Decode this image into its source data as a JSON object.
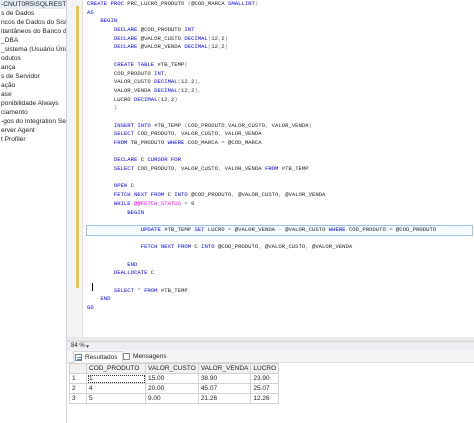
{
  "object_explorer": {
    "items": [
      {
        "label": "-CNUT0R5\\SQLRESTAU"
      },
      {
        "label": "s de Dados"
      },
      {
        "label": "ncos de Dados do Siste"
      },
      {
        "label": "itantâneos do Banco d"
      },
      {
        "label": "_DBA"
      },
      {
        "label": "_sistema (Usuário Únic"
      },
      {
        "label": "odutos"
      },
      {
        "label": "ança"
      },
      {
        "label": "s de Servidor"
      },
      {
        "label": "ação"
      },
      {
        "label": "ase"
      },
      {
        "label": "ponibilidade Always"
      },
      {
        "label": "ciamento"
      },
      {
        "label": "-gos do Integration Ser"
      },
      {
        "label": "erver Agent"
      },
      {
        "label": "t Profiler"
      }
    ]
  },
  "editor": {
    "lines": [
      [
        {
          "c": "k",
          "t": "CREATE PROC "
        },
        {
          "c": "t",
          "t": "PRC_LUCRO_PRODUTO "
        },
        {
          "c": "g",
          "t": "("
        },
        {
          "c": "t",
          "t": "@COD_MARCA "
        },
        {
          "c": "k",
          "t": "SMALLINT"
        },
        {
          "c": "g",
          "t": ")"
        }
      ],
      [
        {
          "c": "k",
          "t": "AS"
        }
      ],
      [
        {
          "c": "k",
          "t": "    BEGIN"
        }
      ],
      [
        {
          "c": "k",
          "t": "        DECLARE "
        },
        {
          "c": "t",
          "t": "@COD_PRODUTO "
        },
        {
          "c": "k",
          "t": "INT"
        }
      ],
      [
        {
          "c": "k",
          "t": "        DECLARE "
        },
        {
          "c": "t",
          "t": "@VALOR_CUSTO "
        },
        {
          "c": "k",
          "t": "DECIMAL"
        },
        {
          "c": "g",
          "t": "("
        },
        {
          "c": "t",
          "t": "12"
        },
        {
          "c": "g",
          "t": ","
        },
        {
          "c": "t",
          "t": "2"
        },
        {
          "c": "g",
          "t": ")"
        }
      ],
      [
        {
          "c": "k",
          "t": "        DECLARE "
        },
        {
          "c": "t",
          "t": "@VALOR_VENDA "
        },
        {
          "c": "k",
          "t": "DECIMAL"
        },
        {
          "c": "g",
          "t": "("
        },
        {
          "c": "t",
          "t": "12"
        },
        {
          "c": "g",
          "t": ","
        },
        {
          "c": "t",
          "t": "2"
        },
        {
          "c": "g",
          "t": ")"
        }
      ],
      [
        {
          "c": "t",
          "t": ""
        }
      ],
      [
        {
          "c": "k",
          "t": "        CREATE TABLE "
        },
        {
          "c": "t",
          "t": "#TB_TEMP"
        },
        {
          "c": "g",
          "t": "("
        }
      ],
      [
        {
          "c": "t",
          "t": "        COD_PRODUTO "
        },
        {
          "c": "k",
          "t": "INT"
        },
        {
          "c": "g",
          "t": ","
        }
      ],
      [
        {
          "c": "t",
          "t": "        VALOR_CUSTO "
        },
        {
          "c": "k",
          "t": "DECIMAL"
        },
        {
          "c": "g",
          "t": "("
        },
        {
          "c": "t",
          "t": "12"
        },
        {
          "c": "g",
          "t": ","
        },
        {
          "c": "t",
          "t": "2"
        },
        {
          "c": "g",
          "t": "),"
        }
      ],
      [
        {
          "c": "t",
          "t": "        VALOR_VENDA "
        },
        {
          "c": "k",
          "t": "DECIMAL"
        },
        {
          "c": "g",
          "t": "("
        },
        {
          "c": "t",
          "t": "12"
        },
        {
          "c": "g",
          "t": ","
        },
        {
          "c": "t",
          "t": "2"
        },
        {
          "c": "g",
          "t": "),"
        }
      ],
      [
        {
          "c": "t",
          "t": "        LUCRO "
        },
        {
          "c": "k",
          "t": "DECIMAL"
        },
        {
          "c": "g",
          "t": "("
        },
        {
          "c": "t",
          "t": "12"
        },
        {
          "c": "g",
          "t": ","
        },
        {
          "c": "t",
          "t": "2"
        },
        {
          "c": "g",
          "t": ")"
        }
      ],
      [
        {
          "c": "g",
          "t": "        )"
        }
      ],
      [
        {
          "c": "t",
          "t": ""
        }
      ],
      [
        {
          "c": "k",
          "t": "        INSERT INTO "
        },
        {
          "c": "t",
          "t": "#TB_TEMP "
        },
        {
          "c": "g",
          "t": "("
        },
        {
          "c": "t",
          "t": "COD_PRODUTO"
        },
        {
          "c": "g",
          "t": ","
        },
        {
          "c": "t",
          "t": "VALOR_CUSTO"
        },
        {
          "c": "g",
          "t": ", "
        },
        {
          "c": "t",
          "t": "VALOR_VENDA"
        },
        {
          "c": "g",
          "t": ")"
        }
      ],
      [
        {
          "c": "k",
          "t": "        SELECT "
        },
        {
          "c": "t",
          "t": "COD_PRODUTO"
        },
        {
          "c": "g",
          "t": ", "
        },
        {
          "c": "t",
          "t": "VALOR_CUSTO"
        },
        {
          "c": "g",
          "t": ", "
        },
        {
          "c": "t",
          "t": "VALOR_VENDA"
        }
      ],
      [
        {
          "c": "k",
          "t": "        FROM "
        },
        {
          "c": "t",
          "t": "TB_PRODUTO "
        },
        {
          "c": "k",
          "t": "WHERE "
        },
        {
          "c": "t",
          "t": "COD_MARCA "
        },
        {
          "c": "g",
          "t": "= "
        },
        {
          "c": "t",
          "t": "@COD_MARCA"
        }
      ],
      [
        {
          "c": "t",
          "t": ""
        }
      ],
      [
        {
          "c": "k",
          "t": "        DECLARE "
        },
        {
          "c": "t",
          "t": "C "
        },
        {
          "c": "k",
          "t": "CURSOR FOR"
        }
      ],
      [
        {
          "c": "k",
          "t": "        SELECT "
        },
        {
          "c": "t",
          "t": "COD_PRODUTO"
        },
        {
          "c": "g",
          "t": ", "
        },
        {
          "c": "t",
          "t": "VALOR_CUSTO"
        },
        {
          "c": "g",
          "t": ", "
        },
        {
          "c": "t",
          "t": "VALOR_VENDA "
        },
        {
          "c": "k",
          "t": "FROM "
        },
        {
          "c": "t",
          "t": "#TB_TEMP"
        }
      ],
      [
        {
          "c": "t",
          "t": ""
        }
      ],
      [
        {
          "c": "k",
          "t": "        OPEN "
        },
        {
          "c": "t",
          "t": "C"
        }
      ],
      [
        {
          "c": "k",
          "t": "        FETCH NEXT FROM "
        },
        {
          "c": "t",
          "t": "C "
        },
        {
          "c": "k",
          "t": "INTO "
        },
        {
          "c": "t",
          "t": "@COD_PRODUTO"
        },
        {
          "c": "g",
          "t": ", "
        },
        {
          "c": "t",
          "t": "@VALOR_CUSTO"
        },
        {
          "c": "g",
          "t": ", "
        },
        {
          "c": "t",
          "t": "@VALOR_VENDA"
        }
      ],
      [
        {
          "c": "k",
          "t": "        WHILE "
        },
        {
          "c": "f",
          "t": "@@FETCH_STATUS "
        },
        {
          "c": "g",
          "t": "= "
        },
        {
          "c": "t",
          "t": "0"
        }
      ],
      [
        {
          "c": "k",
          "t": "            BEGIN"
        }
      ],
      [
        {
          "c": "t",
          "t": ""
        }
      ],
      [
        {
          "c": "k",
          "t": "                UPDATE "
        },
        {
          "c": "t",
          "t": "#TB_TEMP "
        },
        {
          "c": "k",
          "t": "SET "
        },
        {
          "c": "t",
          "t": "LUCRO "
        },
        {
          "c": "g",
          "t": "= "
        },
        {
          "c": "t",
          "t": "@VALOR_VENDA "
        },
        {
          "c": "g",
          "t": "- "
        },
        {
          "c": "t",
          "t": "@VALOR_CUSTO "
        },
        {
          "c": "k",
          "t": "WHERE "
        },
        {
          "c": "t",
          "t": "COD_PRODUTO "
        },
        {
          "c": "g",
          "t": "= "
        },
        {
          "c": "t",
          "t": "@COD_PRODUTO"
        }
      ],
      [
        {
          "c": "t",
          "t": ""
        }
      ],
      [
        {
          "c": "k",
          "t": "                FETCH NEXT FROM "
        },
        {
          "c": "t",
          "t": "C "
        },
        {
          "c": "k",
          "t": "INTO "
        },
        {
          "c": "t",
          "t": "@COD_PRODUTO"
        },
        {
          "c": "g",
          "t": ", "
        },
        {
          "c": "t",
          "t": "@VALOR_CUSTO"
        },
        {
          "c": "g",
          "t": ", "
        },
        {
          "c": "t",
          "t": "@VALOR_VENDA"
        }
      ],
      [
        {
          "c": "t",
          "t": ""
        }
      ],
      [
        {
          "c": "k",
          "t": "            END"
        }
      ],
      [
        {
          "c": "k",
          "t": "        DEALLOCATE "
        },
        {
          "c": "t",
          "t": "C"
        }
      ],
      [
        {
          "c": "t",
          "t": ""
        }
      ],
      [
        {
          "c": "k",
          "t": "        SELECT "
        },
        {
          "c": "g",
          "t": "* "
        },
        {
          "c": "k",
          "t": "FROM "
        },
        {
          "c": "t",
          "t": "#TB_TEMP"
        }
      ],
      [
        {
          "c": "k",
          "t": "    END"
        }
      ],
      [
        {
          "c": "k",
          "t": "GO"
        }
      ],
      [
        {
          "c": "t",
          "t": ""
        }
      ],
      [
        {
          "c": "t",
          "t": ""
        }
      ]
    ]
  },
  "zoom": {
    "value": "84 %"
  },
  "results": {
    "tabs": [
      {
        "label": "Resultados"
      },
      {
        "label": "Mensagens"
      }
    ],
    "columns": [
      "COD_PRODUTO",
      "VALOR_CUSTO",
      "VALOR_VENDA",
      "LUCRO"
    ],
    "rows": [
      {
        "num": "1",
        "cells": [
          "1",
          "15.00",
          "38.90",
          "23.90"
        ]
      },
      {
        "num": "2",
        "cells": [
          "4",
          "20.00",
          "45.07",
          "25.07"
        ]
      },
      {
        "num": "3",
        "cells": [
          "5",
          "9.00",
          "21.26",
          "12.26"
        ]
      }
    ]
  }
}
